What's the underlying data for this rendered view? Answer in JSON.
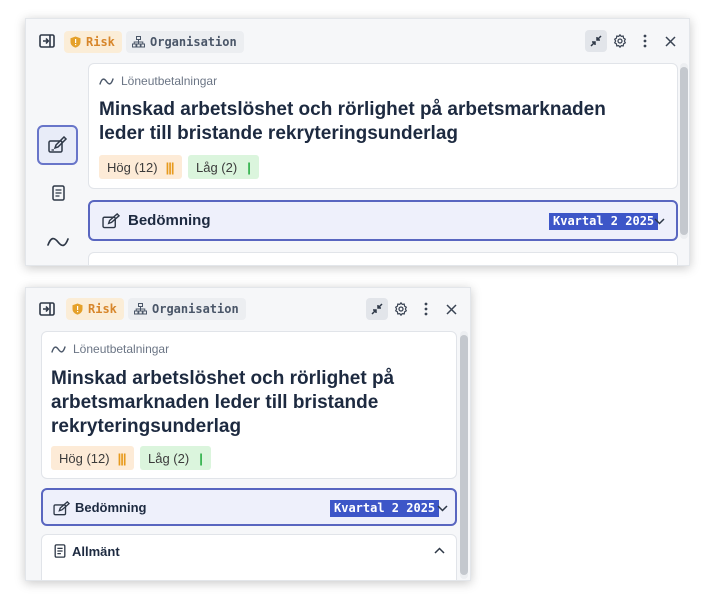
{
  "toolbar": {
    "risk_label": "Risk",
    "org_label": "Organisation"
  },
  "risk": {
    "breadcrumb": "Löneutbetalningar",
    "title": "Minskad arbetslöshet och rörlighet på arbetsmarknaden leder till bristande rekryteringsunderlag",
    "title_a_line1": "Minskad arbetslöshet och rörlighet på arbetsmarknaden",
    "title_a_line2": "leder till bristande rekryteringsunderlag",
    "title_b_line1": "Minskad arbetslöshet och rörlighet på",
    "title_b_line2": "arbetsmarknaden leder till bristande",
    "title_b_line3": "rekryteringsunderlag",
    "impact_label": "Hög (12)",
    "impact_level": 3,
    "likelihood_label": "Låg (2)",
    "likelihood_level": 1
  },
  "assessment": {
    "label": "Bedömning",
    "period": "Kvartal 2 2025"
  },
  "general": {
    "label": "Allmänt"
  },
  "colors": {
    "accent": "#3d56c8",
    "risk_tag": "#d7862b",
    "high": "#e79a1e",
    "low": "#2fb14a"
  }
}
